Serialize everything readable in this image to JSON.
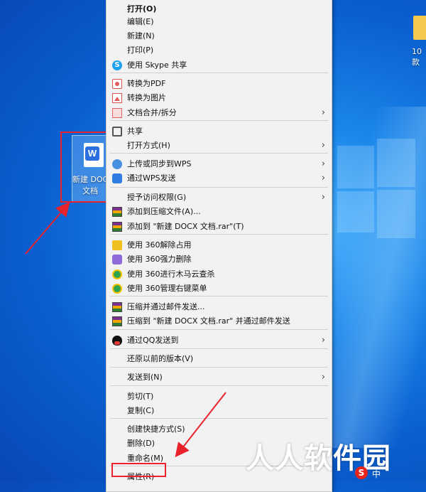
{
  "desktop": {
    "file_label_line1": "新建 DOC",
    "file_label_line2": "文档",
    "file_badge": "W",
    "folder_label": "10款"
  },
  "menu": {
    "items": [
      {
        "label": "打开(O)",
        "icon": "open",
        "bold": true
      },
      {
        "label": "编辑(E)",
        "icon": "none"
      },
      {
        "label": "新建(N)",
        "icon": "none"
      },
      {
        "label": "打印(P)",
        "icon": "none"
      },
      {
        "label": "使用 Skype 共享",
        "icon": "skype-icon"
      },
      {
        "label": "转换为PDF",
        "icon": "pdf-icon"
      },
      {
        "label": "转换为图片",
        "icon": "image-icon"
      },
      {
        "label": "文档合并/拆分",
        "icon": "merge-icon",
        "submenu": true
      },
      {
        "label": "共享",
        "icon": "share-icon"
      },
      {
        "label": "打开方式(H)",
        "icon": "none",
        "submenu": true
      },
      {
        "label": "上传或同步到WPS",
        "icon": "cloud-upload-icon",
        "submenu": true
      },
      {
        "label": "通过WPS发送",
        "icon": "wps-send-icon",
        "submenu": true
      },
      {
        "label": "授予访问权限(G)",
        "icon": "none",
        "submenu": true
      },
      {
        "label": "添加到压缩文件(A)...",
        "icon": "winrar-icon"
      },
      {
        "label": "添加到 \"新建 DOCX 文档.rar\"(T)",
        "icon": "winrar-icon"
      },
      {
        "label": "使用 360解除占用",
        "icon": "360-unlock-icon"
      },
      {
        "label": "使用 360强力删除",
        "icon": "360-delete-icon"
      },
      {
        "label": "使用 360进行木马云查杀",
        "icon": "360-scan-icon"
      },
      {
        "label": "使用 360管理右键菜单",
        "icon": "360-scan-icon"
      },
      {
        "label": "压缩并通过邮件发送...",
        "icon": "winrar-icon"
      },
      {
        "label": "压缩到 \"新建 DOCX 文档.rar\" 并通过邮件发送",
        "icon": "winrar-icon"
      },
      {
        "label": "通过QQ发送到",
        "icon": "qq-icon",
        "submenu": true
      },
      {
        "label": "还原以前的版本(V)",
        "icon": "none"
      },
      {
        "label": "发送到(N)",
        "icon": "none",
        "submenu": true
      },
      {
        "label": "剪切(T)",
        "icon": "none"
      },
      {
        "label": "复制(C)",
        "icon": "none"
      },
      {
        "label": "创建快捷方式(S)",
        "icon": "none"
      },
      {
        "label": "删除(D)",
        "icon": "none"
      },
      {
        "label": "重命名(M)",
        "icon": "none"
      },
      {
        "label": "属性(R)",
        "icon": "none"
      }
    ]
  },
  "watermark": "人人软件园",
  "taskbar": {
    "sogou_badge": "S",
    "ime_text": "中"
  },
  "colors": {
    "highlight_red": "#e8232c",
    "menu_bg": "#f2f2f2",
    "desktop_blue": "#0a5fd0"
  }
}
